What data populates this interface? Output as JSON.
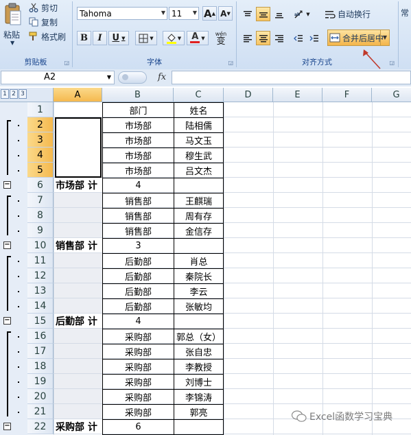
{
  "ribbon": {
    "clipboard": {
      "paste_label": "粘贴",
      "cut_label": "剪切",
      "copy_label": "复制",
      "format_painter_label": "格式刷",
      "group_label": "剪贴板"
    },
    "font": {
      "font_name": "Tahoma",
      "font_size": "11",
      "bold": "B",
      "italic": "I",
      "underline": "U",
      "font_color_glyph": "A",
      "wen_glyph": "wén",
      "bian_glyph": "变",
      "grow_glyph": "A",
      "shrink_glyph": "A",
      "group_label": "字体"
    },
    "alignment": {
      "wrap_text_label": "自动换行",
      "merge_center_label": "合并后居中",
      "group_label": "对齐方式"
    },
    "number": {
      "partial_label": "常"
    }
  },
  "formula_bar": {
    "name_box": "A2",
    "fx_label": "fx",
    "formula": ""
  },
  "sheet": {
    "outline_levels": [
      "1",
      "2",
      "3"
    ],
    "columns": [
      "A",
      "B",
      "C",
      "D",
      "E",
      "F",
      "G"
    ],
    "row_numbers": [
      "1",
      "2",
      "3",
      "4",
      "5",
      "6",
      "7",
      "8",
      "9",
      "10",
      "11",
      "12",
      "13",
      "14",
      "15",
      "16",
      "17",
      "18",
      "19",
      "20",
      "21",
      "22"
    ],
    "header": {
      "b": "部门",
      "c": "姓名"
    },
    "rows": [
      {
        "b": "市场部",
        "c": "陆相儒"
      },
      {
        "b": "市场部",
        "c": "马文玉"
      },
      {
        "b": "市场部",
        "c": "穆生武"
      },
      {
        "b": "市场部",
        "c": "吕文杰"
      },
      {
        "a": "市场部 计",
        "b": "4",
        "c": ""
      },
      {
        "b": "销售部",
        "c": "王麒瑞"
      },
      {
        "b": "销售部",
        "c": "周有存"
      },
      {
        "b": "销售部",
        "c": "金信存"
      },
      {
        "a": "销售部 计",
        "b": "3",
        "c": ""
      },
      {
        "b": "后勤部",
        "c": "肖总"
      },
      {
        "b": "后勤部",
        "c": "秦院长"
      },
      {
        "b": "后勤部",
        "c": "李云"
      },
      {
        "b": "后勤部",
        "c": "张敏均"
      },
      {
        "a": "后勤部 计",
        "b": "4",
        "c": ""
      },
      {
        "b": "采购部",
        "c": "郭总（女）"
      },
      {
        "b": "采购部",
        "c": "张自忠"
      },
      {
        "b": "采购部",
        "c": "李教授"
      },
      {
        "b": "采购部",
        "c": "刘博士"
      },
      {
        "b": "采购部",
        "c": "李锦涛"
      },
      {
        "b": "采购部",
        "c": "郭亮"
      },
      {
        "a": "采购部 计",
        "b": "6",
        "c": ""
      }
    ]
  },
  "watermark": "Excel函数学习宝典",
  "colors": {
    "selected_header": "#f5b94e",
    "ribbon_bg": "#d6e4f5",
    "annotation_arrow": "#c0392b"
  }
}
